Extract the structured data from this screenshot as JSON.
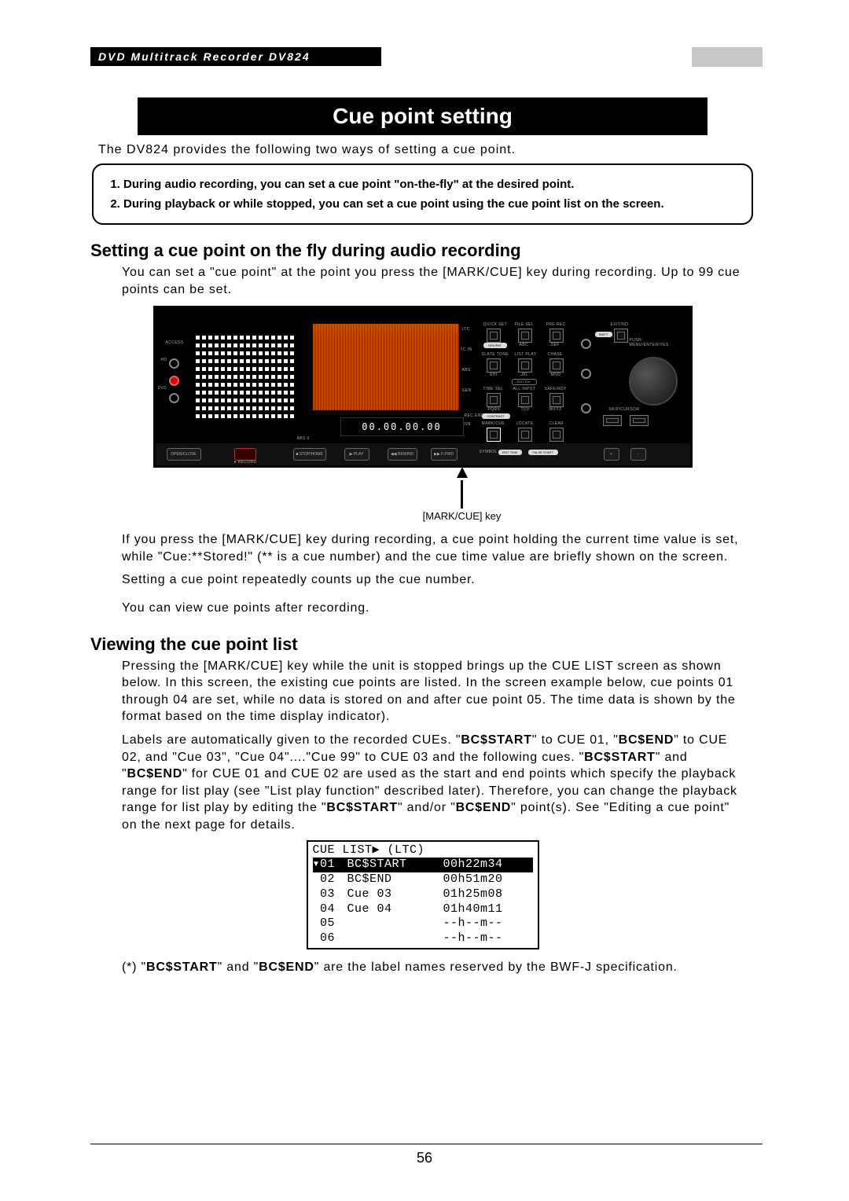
{
  "header": {
    "product_line": "DVD Multitrack Recorder DV824"
  },
  "title": "Cue point setting",
  "intro": "The DV824 provides the following two ways of setting a cue point.",
  "methods": [
    "During audio recording, you can set a cue point \"on-the-fly\" at the desired point.",
    "During playback or while stopped, you can set a cue point using the cue point list on the screen."
  ],
  "section1": {
    "heading": "Setting a cue point on the fly during audio recording",
    "p1": "You can set a \"cue point\" at the point you press the [MARK/CUE] key during recording. Up to 99 cue points can be set.",
    "fig": {
      "timecode": "00.00.00.00",
      "caption": "[MARK/CUE] key",
      "leds": {
        "access": "ACCESS",
        "hd": "HD",
        "dvd": "DVD"
      },
      "side_labels": {
        "ltc": "LTC",
        "tcin": "TC IN",
        "abs": "ABS",
        "gen": "GEN",
        "on": "ON"
      },
      "buttons": {
        "row1": [
          "QUICK SET",
          "FILE SEL",
          "PRE REC",
          "",
          "EXIT/NO"
        ],
        "row1sub": [
          "ABC",
          "DEF",
          "",
          "",
          ""
        ],
        "drv_pill": "DRV/PAT",
        "shift_pill": "SHIFT",
        "push_lab": "PUSH: MENU/ENTER/YES",
        "row2": [
          "SLATE TONE",
          "LIST PLAY",
          "CHASE"
        ],
        "row2sub": [
          "GHI",
          "JKL",
          "MNO"
        ],
        "edit_pill": "EDIT EDL",
        "row3": [
          "TIME SEL",
          "ALL INPUT",
          "SAFE/RDY"
        ],
        "row3sub": [
          "PQRS",
          "TUV",
          "WXYZ"
        ],
        "contrast_pill": "CONTRAST",
        "row4": [
          "MARK/CUE",
          "LOCATE",
          "CLEAR"
        ],
        "row4sub": [
          "EDIT TIME",
          "FALSE START",
          "+",
          "-"
        ],
        "skip_lab": "SKIP/CURSOR",
        "recend_lab": "REC END",
        "symbol_lab": "SYMBOL"
      },
      "transport": {
        "abs0": "ABS 0",
        "open": "OPEN/CLOSE",
        "record": "● RECORD",
        "stop": "■ STOP/HOME",
        "play": "▶ PLAY",
        "rew": "◀◀ REWIND",
        "ff": "▶▶ F FWD"
      }
    },
    "p2": "If you press the [MARK/CUE] key during recording, a cue point holding the current time value is set, while \"Cue:**Stored!\" (** is a cue number) and the cue time value are briefly shown on the screen.",
    "p3": "Setting a cue point repeatedly counts up the cue number.",
    "p4": "You can view cue points after recording."
  },
  "section2": {
    "heading": "Viewing the cue point list",
    "p1": "Pressing the [MARK/CUE] key while the unit is stopped brings up the CUE LIST screen as shown below. In this screen, the existing cue points are listed. In the screen example below, cue points 01 through 04 are set, while no data is stored on and after cue point 05. The time data is shown by the format based on the time display indicator).",
    "p2a": "Labels are automatically given to the recorded CUEs. \"",
    "p2b": "\" to CUE 01, \"",
    "p2c": "\" to CUE 02, and \"Cue 03\", \"Cue 04\"....\"Cue 99\" to CUE 03 and the following cues. \"",
    "p2d": "\" and \"",
    "p2e": "\" for CUE 01 and CUE 02 are used as the start and end points which specify the playback range for list play (see \"List play function\" described later). Therefore, you can change the playback range for list play by editing the \"",
    "p2f": "\" and/or \"",
    "p2g": "\" point(s). See \"Editing a cue point\" on the next page for details.",
    "labels": {
      "bcstart": "BC$START",
      "bcend": "BC$END"
    },
    "cuelist": {
      "header": "CUE LIST▶ (LTC)",
      "rows": [
        {
          "id": "01",
          "name": "BC$START",
          "time": "00h22m34",
          "hl": true,
          "marker": "▾"
        },
        {
          "id": "02",
          "name": "BC$END",
          "time": "00h51m20"
        },
        {
          "id": "03",
          "name": "Cue 03",
          "time": "01h25m08"
        },
        {
          "id": "04",
          "name": "Cue 04",
          "time": "01h40m11"
        },
        {
          "id": "05",
          "name": "",
          "time": "--h--m--"
        },
        {
          "id": "06",
          "name": "",
          "time": "--h--m--"
        }
      ]
    },
    "footnote_a": "(*) \"",
    "footnote_b": "\" and \"",
    "footnote_c": "\" are the label names reserved by the BWF-J specification."
  },
  "page_number": "56"
}
